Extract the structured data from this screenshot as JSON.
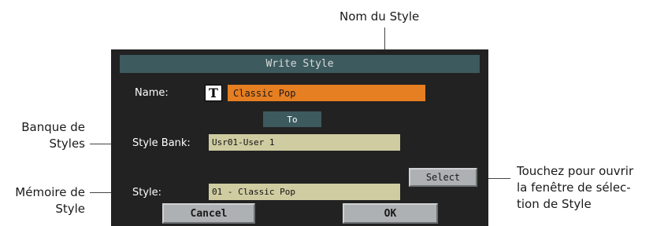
{
  "callouts": {
    "style_name": "Nom du Style",
    "style_bank_line1": "Banque de",
    "style_bank_line2": "Styles",
    "style_memory_line1": "Mémoire de",
    "style_memory_line2": "Style",
    "select_line1": "Touchez pour ouvrir",
    "select_line2": "la fenêtre de sélec-",
    "select_line3": "tion de Style"
  },
  "dialog": {
    "title": "Write Style",
    "name_label": "Name:",
    "text_edit_icon": "T",
    "name_value": "Classic Pop",
    "to_label": "To",
    "style_bank_label": "Style Bank:",
    "style_bank_value": "Usr01-User 1",
    "style_label": "Style:",
    "style_value": "01 - Classic Pop",
    "select_button": "Select",
    "cancel_button": "Cancel",
    "ok_button": "OK"
  },
  "colors": {
    "dialog_bg": "#222222",
    "title_bar": "#3d5a5e",
    "name_field": "#e67e22",
    "value_field": "#cfcca1",
    "button": "#aeb1b3"
  }
}
